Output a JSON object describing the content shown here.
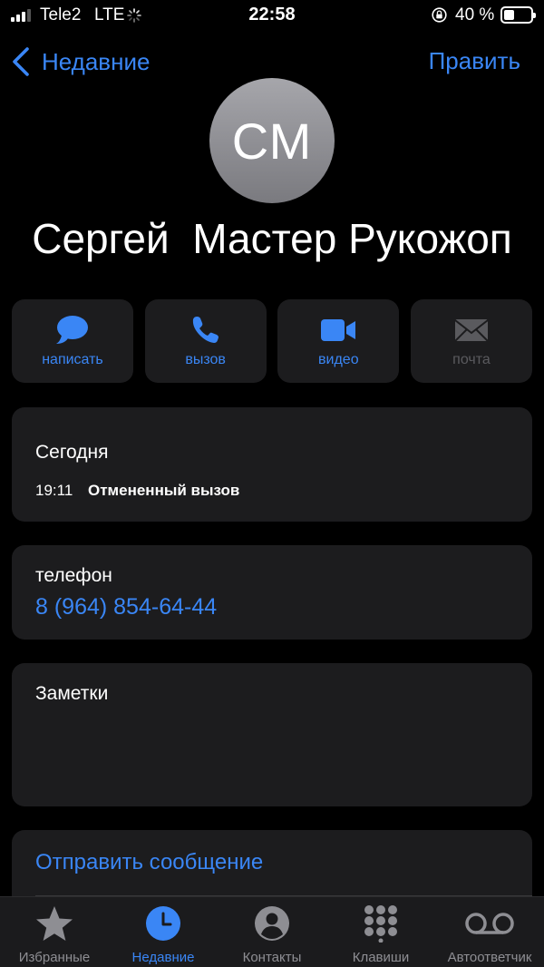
{
  "status_bar": {
    "carrier": "Tele2",
    "network": "LTE",
    "time": "22:58",
    "battery_text": "40 %",
    "battery_level": 0.4,
    "signal_bars_active": 3,
    "signal_bars_total": 4
  },
  "nav": {
    "back_label": "Недавние",
    "edit_label": "Править"
  },
  "contact": {
    "initials": "СМ",
    "name": "Сергей  Мастер Рукожоп"
  },
  "actions": [
    {
      "label": "написать",
      "icon": "message-bubble-icon",
      "enabled": true
    },
    {
      "label": "вызов",
      "icon": "phone-icon",
      "enabled": true
    },
    {
      "label": "видео",
      "icon": "video-camera-icon",
      "enabled": true
    },
    {
      "label": "почта",
      "icon": "envelope-icon",
      "enabled": false
    }
  ],
  "history": {
    "day": "Сегодня",
    "time": "19:11",
    "status": "Отмененный вызов"
  },
  "phone": {
    "label": "телефон",
    "number": "8 (964) 854-64-44"
  },
  "notes": {
    "label": "Заметки"
  },
  "send_message": {
    "label": "Отправить сообщение"
  },
  "tabs": [
    {
      "label": "Избранные",
      "icon": "star-icon",
      "active": false
    },
    {
      "label": "Недавние",
      "icon": "clock-icon",
      "active": true
    },
    {
      "label": "Контакты",
      "icon": "person-circle-icon",
      "active": false
    },
    {
      "label": "Клавиши",
      "icon": "keypad-icon",
      "active": false
    },
    {
      "label": "Автоответчик",
      "icon": "voicemail-icon",
      "active": false
    }
  ],
  "colors": {
    "accent": "#3a86f5",
    "background": "#000000",
    "card": "#1c1c1e",
    "inactive": "#8e8e93"
  }
}
